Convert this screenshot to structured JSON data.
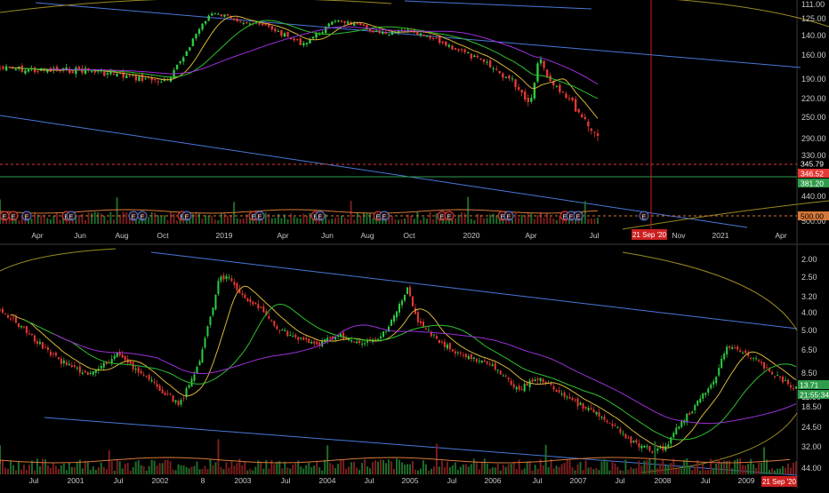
{
  "top_panel": {
    "price_ticks": [
      "111.00",
      "125.00",
      "140.00",
      "160.00",
      "190.00",
      "220.00",
      "250.00",
      "290.00",
      "330.00",
      "440.00",
      "500.00"
    ],
    "labels": [
      {
        "text": "345.79",
        "bg": "#000000",
        "fg": "#ffffff"
      },
      {
        "text": "346.52",
        "bg": "#e53935",
        "fg": "#ffffff"
      },
      {
        "text": "381.20",
        "bg": "#2e9c4a",
        "fg": "#ffffff"
      },
      {
        "text": "500.00",
        "bg": "#d7783a",
        "fg": "#000000"
      }
    ],
    "time_ticks": [
      "Apr",
      "Jun",
      "Aug",
      "Oct",
      "2019",
      "Apr",
      "Jun",
      "Aug",
      "Oct",
      "2020",
      "Apr",
      "Jul",
      "Sep",
      "Nov",
      "2021",
      "Apr"
    ],
    "date_marker": "21 Sep '20",
    "earnings_mark": "E"
  },
  "bottom_panel": {
    "price_ticks": [
      "2.00",
      "2.50",
      "3.20",
      "4.00",
      "5.00",
      "6.50",
      "8.50",
      "11.50",
      "13.71",
      "18.50",
      "24.50",
      "32.00",
      "44.00"
    ],
    "labels": [
      {
        "text": "13.71",
        "bg": "#2e9c4a",
        "fg": "#ffffff"
      },
      {
        "text": "21:55:34",
        "bg": "#2e9c4a",
        "fg": "#ffffff"
      }
    ],
    "time_ticks": [
      "Jul",
      "2001",
      "Jul",
      "2002",
      "8",
      "2003",
      "Jul",
      "2004",
      "Jul",
      "2005",
      "Jul",
      "2006",
      "Jul",
      "2007",
      "Jul",
      "2008",
      "Jul",
      "2009",
      "Jul"
    ],
    "date_marker": "21 Sep '20"
  },
  "colors": {
    "background": "#000000",
    "candle_up": "#2ecc40",
    "candle_down": "#e53935",
    "trendline": "#4a78d8",
    "ma_fast": "#d8b53a",
    "ma_mid": "#2fbf2f",
    "ma_slow": "#9c2fd8",
    "arc": "#9a8a22",
    "marker_line": "#cc1f1f"
  },
  "chart_data": [
    {
      "type": "candlestick",
      "title": "",
      "price_scale": "inverted",
      "x_ticks": [
        "Apr",
        "Jun",
        "Aug",
        "Oct",
        "2019",
        "Apr",
        "Jun",
        "Aug",
        "Oct",
        "2020",
        "Apr",
        "Jul",
        "Sep",
        "Nov",
        "2021",
        "Apr"
      ],
      "y_ticks": [
        111,
        125,
        140,
        160,
        190,
        220,
        250,
        290,
        330,
        440,
        500
      ],
      "close_path": [
        [
          0,
          225
        ],
        [
          5,
          230
        ],
        [
          10,
          228
        ],
        [
          15,
          240
        ],
        [
          20,
          250
        ],
        [
          21,
          225
        ],
        [
          23,
          170
        ],
        [
          24,
          145
        ],
        [
          25,
          125
        ],
        [
          27,
          130
        ],
        [
          29,
          140
        ],
        [
          32,
          150
        ],
        [
          35,
          175
        ],
        [
          36,
          180
        ],
        [
          38,
          160
        ],
        [
          40,
          135
        ],
        [
          43,
          150
        ],
        [
          46,
          165
        ],
        [
          48,
          155
        ],
        [
          52,
          175
        ],
        [
          55,
          195
        ],
        [
          58,
          220
        ],
        [
          61,
          250
        ],
        [
          63,
          290
        ],
        [
          64,
          200
        ],
        [
          65,
          240
        ],
        [
          67,
          270
        ],
        [
          69,
          310
        ],
        [
          71,
          350
        ]
      ]
    },
    {
      "type": "candlestick",
      "title": "",
      "price_scale": "inverted-log",
      "x_ticks": [
        "Jul",
        "2001",
        "Jul",
        "2002",
        "8",
        "2003",
        "Jul",
        "2004",
        "Jul",
        "2005",
        "Jul",
        "2006",
        "Jul",
        "2007",
        "Jul",
        "2008",
        "Jul",
        "2009",
        "Jul"
      ],
      "y_ticks": [
        2.0,
        2.5,
        3.2,
        4.0,
        5.0,
        6.5,
        8.5,
        11.5,
        13.71,
        18.5,
        24.5,
        32.0,
        44.0
      ],
      "close_path": [
        [
          0,
          4
        ],
        [
          3,
          6
        ],
        [
          6,
          9
        ],
        [
          9,
          11
        ],
        [
          12,
          8
        ],
        [
          15,
          12
        ],
        [
          18,
          17
        ],
        [
          20,
          9
        ],
        [
          21,
          5
        ],
        [
          22,
          2.6
        ],
        [
          23,
          2.5
        ],
        [
          24,
          3.3
        ],
        [
          26,
          4
        ],
        [
          28,
          5.5
        ],
        [
          30,
          6.5
        ],
        [
          32,
          7
        ],
        [
          34,
          6
        ],
        [
          36,
          7
        ],
        [
          38,
          6.5
        ],
        [
          40,
          4
        ],
        [
          41,
          3
        ],
        [
          42,
          5
        ],
        [
          44,
          6.5
        ],
        [
          46,
          8
        ],
        [
          48,
          9
        ],
        [
          50,
          10
        ],
        [
          52,
          14
        ],
        [
          54,
          11.5
        ],
        [
          56,
          14
        ],
        [
          58,
          17
        ],
        [
          60,
          20
        ],
        [
          62,
          25
        ],
        [
          64,
          32
        ],
        [
          66,
          35
        ],
        [
          67,
          32
        ],
        [
          68,
          24
        ],
        [
          70,
          17
        ],
        [
          72,
          11
        ],
        [
          73,
          7
        ],
        [
          75,
          8
        ],
        [
          77,
          10
        ],
        [
          79,
          12.5
        ],
        [
          80,
          13.7
        ]
      ]
    }
  ]
}
